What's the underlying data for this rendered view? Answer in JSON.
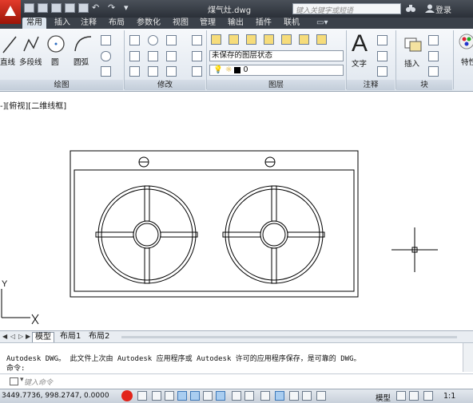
{
  "title_bar": {
    "doc_title": "煤气灶.dwg",
    "search_placeholder": "键入关键字或短语",
    "login_label": "登录"
  },
  "ribbon_tabs": [
    "常用",
    "插入",
    "注释",
    "布局",
    "参数化",
    "视图",
    "管理",
    "输出",
    "插件",
    "联机"
  ],
  "active_tab": "常用",
  "ribbon": {
    "draw": {
      "line": "直线",
      "polyline": "多段线",
      "circle": "圆",
      "arc": "圆弧",
      "title": "绘图"
    },
    "modify": {
      "title": "修改"
    },
    "layers": {
      "state": "未保存的图层状态",
      "current_layer": "0",
      "title": "图层"
    },
    "annotation": {
      "text": "文字",
      "title": "注释"
    },
    "block": {
      "insert": "插入",
      "title": "块"
    },
    "properties": {
      "label": "特性"
    }
  },
  "viewport_label": "-][俯视][二维线框]",
  "ucs": {
    "y_label": "Y"
  },
  "layout_tabs": [
    "模型",
    "布局1",
    "布局2"
  ],
  "active_layout": "模型",
  "command": {
    "history": "Autodesk DWG。  此文件上次由 Autodesk 应用程序或 Autodesk 许可的应用程序保存，是可靠的 DWG。",
    "prompt": "命令:",
    "input_placeholder": "键入命令"
  },
  "status_bar": {
    "coordinates": "3449.7736, 998.2747, 0.0000",
    "model_label": "模型",
    "scale": "1:1"
  },
  "colors": {
    "title_bg": "#2b3038",
    "ribbon_bg": "#dfe6ee",
    "app_button": "#c8281a",
    "record_dot": "#e2241a"
  }
}
